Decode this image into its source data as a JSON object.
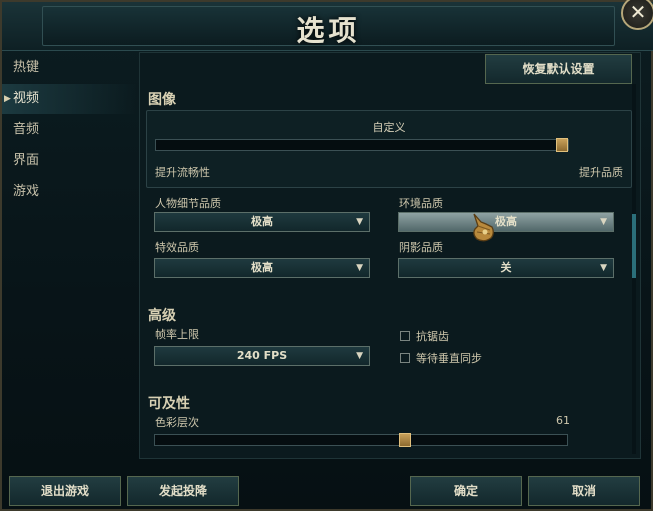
{
  "window": {
    "title": "选项",
    "close_glyph": "✕"
  },
  "sidebar": {
    "items": [
      {
        "label": "热键"
      },
      {
        "label": "视频"
      },
      {
        "label": "音频"
      },
      {
        "label": "界面"
      },
      {
        "label": "游戏"
      }
    ],
    "active_index": 1
  },
  "toolbar": {
    "reset_label": "恢复默认设置"
  },
  "image": {
    "section_title": "图像",
    "preset_label": "自定义",
    "slider_value": 1.0,
    "left_label": "提升流畅性",
    "right_label": "提升品质",
    "character_quality": {
      "label": "人物细节品质",
      "value": "极高"
    },
    "environment_quality": {
      "label": "环境品质",
      "value": "极高"
    },
    "effects_quality": {
      "label": "特效品质",
      "value": "极高"
    },
    "shadow_quality": {
      "label": "阴影品质",
      "value": "关"
    }
  },
  "advanced": {
    "section_title": "高级",
    "fps_label": "帧率上限",
    "fps_value": "240 FPS",
    "antialias_label": "抗锯齿",
    "antialias_checked": false,
    "vsync_label": "等待垂直同步",
    "vsync_checked": false
  },
  "accessibility": {
    "section_title": "可及性",
    "color_level_label": "色彩层次",
    "color_level_value": "61",
    "color_level_fraction": 0.61
  },
  "footer": {
    "exit_label": "退出游戏",
    "surrender_label": "发起投降",
    "ok_label": "确定",
    "cancel_label": "取消"
  },
  "icons": {
    "chevron": "chevron-down-icon",
    "cursor": "gauntlet-cursor-icon",
    "sidebar_marker": "arrow-right-icon"
  },
  "colors": {
    "accent": "#2b6f7a",
    "gold": "#c9a15a"
  }
}
